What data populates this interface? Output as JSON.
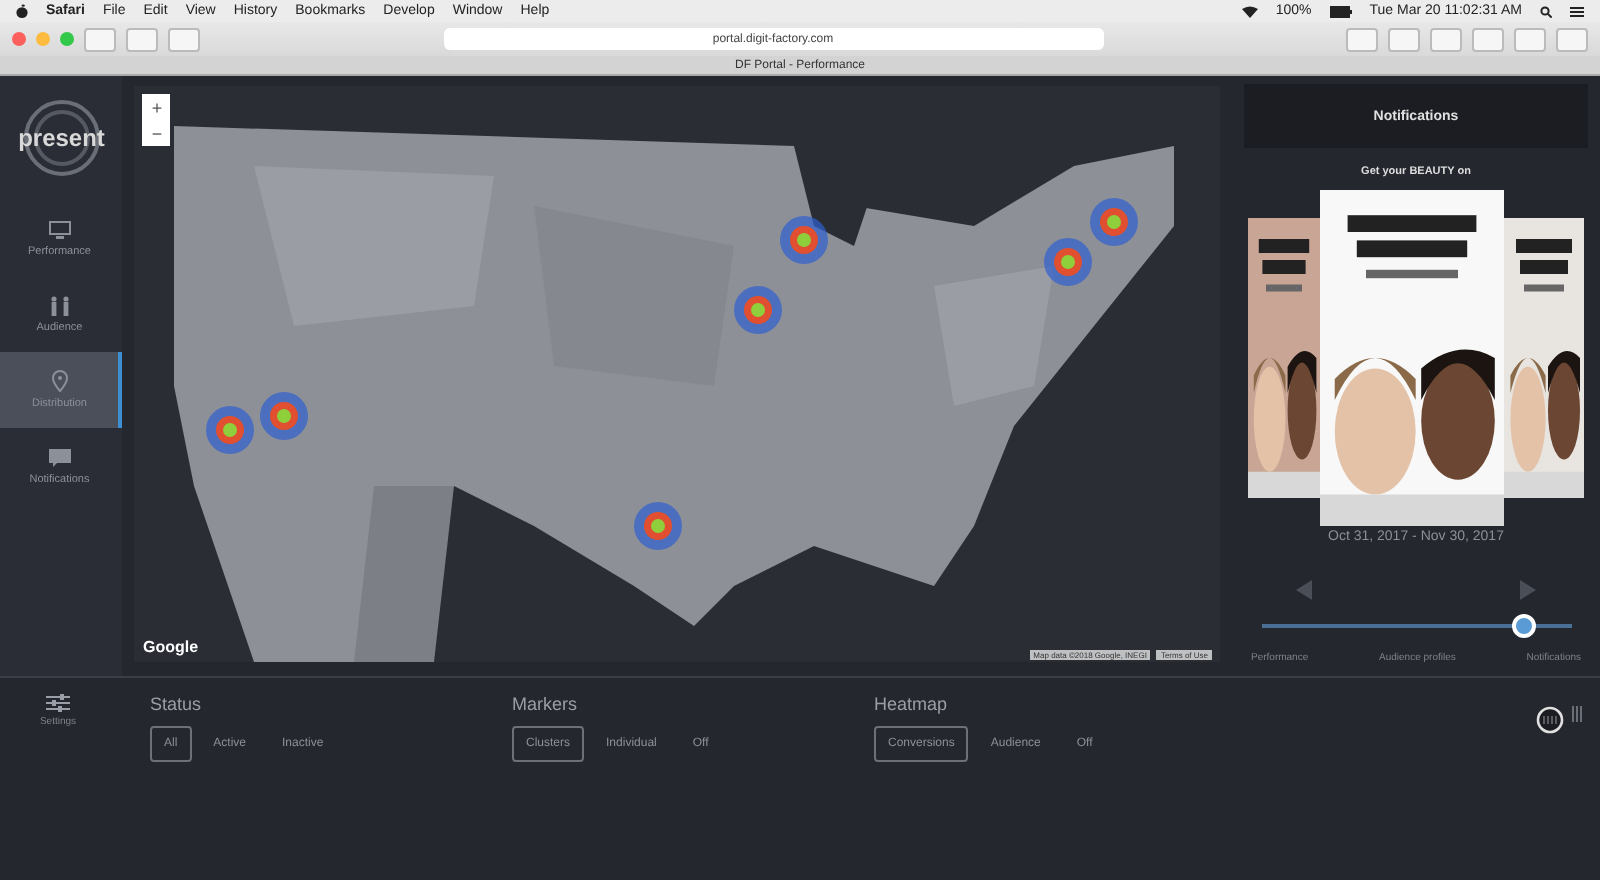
{
  "menubar": {
    "app": "Safari",
    "items": [
      "File",
      "Edit",
      "View",
      "History",
      "Bookmarks",
      "Develop",
      "Window",
      "Help"
    ],
    "battery": "100%",
    "clock": "Tue Mar 20  11:02:31 AM"
  },
  "browser": {
    "url": "portal.digit-factory.com",
    "tab_title": "DF Portal - Performance"
  },
  "sidebar": {
    "logo": "present",
    "items": [
      {
        "label": "Performance",
        "kind": "monitor",
        "selected": false
      },
      {
        "label": "Audience",
        "kind": "people",
        "selected": false
      },
      {
        "label": "Distribution",
        "kind": "pin",
        "selected": true
      },
      {
        "label": "Notifications",
        "kind": "message",
        "selected": false
      }
    ]
  },
  "map": {
    "zoom_in": "+",
    "zoom_out": "−",
    "logo": "Google",
    "attribution": "Map data ©2018 Google, INEGI",
    "terms": "Terms of Use"
  },
  "notifications": {
    "title": "Notifications",
    "heading": "Get your BEAUTY on",
    "date_range": "Oct 31, 2017 - Nov 30, 2017",
    "slider": {
      "level": 0.85,
      "steps": [
        "Performance",
        "Audience profiles",
        "Notifications"
      ]
    }
  },
  "settings": {
    "label": "Settings"
  },
  "filters": [
    {
      "title": "Status",
      "options": [
        {
          "label": "All",
          "selected": true
        },
        {
          "label": "Active",
          "selected": false
        },
        {
          "label": "Inactive",
          "selected": false
        }
      ]
    },
    {
      "title": "Markers",
      "options": [
        {
          "label": "Clusters",
          "selected": true
        },
        {
          "label": "Individual",
          "selected": false
        },
        {
          "label": "Off",
          "selected": false
        }
      ]
    },
    {
      "title": "Heatmap",
      "options": [
        {
          "label": "Conversions",
          "selected": true
        },
        {
          "label": "Audience",
          "selected": false
        },
        {
          "label": "Off",
          "selected": false
        }
      ]
    }
  ]
}
